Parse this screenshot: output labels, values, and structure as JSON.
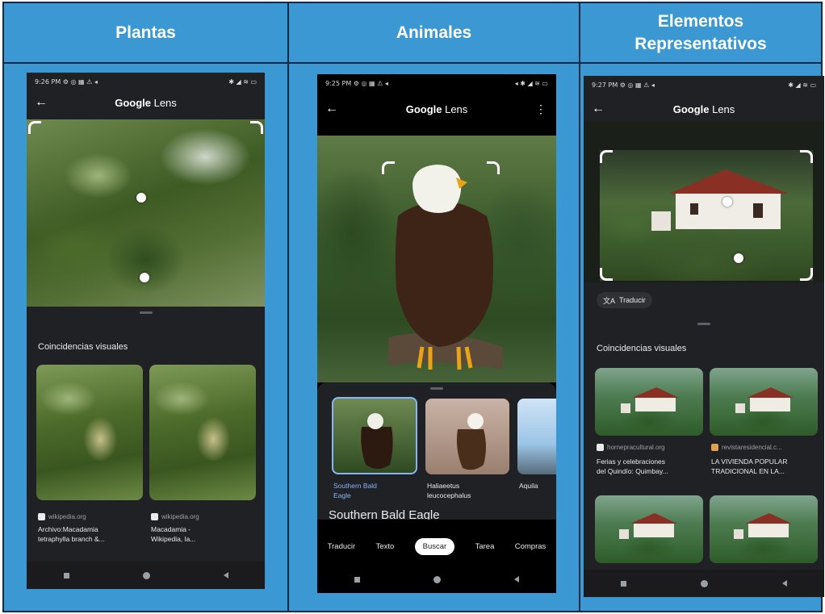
{
  "headers": {
    "col1": "Plantas",
    "col2": "Animales",
    "col3_line1": "Elementos",
    "col3_line2": "Representativos"
  },
  "phones": {
    "plantas": {
      "status_time": "9:26 PM ⚙ ◎ ▦ ⚠ ◂",
      "status_right": "✱ ◢ ≋ ▭",
      "app_title_bold": "Google",
      "app_title_rest": " Lens",
      "section_title": "Coincidencias visuales",
      "results": [
        {
          "source": "wikipedia.org",
          "desc_line1": "Archivo:Macadamia",
          "desc_line2": "tetraphylla branch &..."
        },
        {
          "source": "wikipedia.org",
          "desc_line1": "Macadamia -",
          "desc_line2": "Wikipedia, la..."
        }
      ]
    },
    "animales": {
      "status_time": "9:25 PM ⚙ ◎ ▦ ⚠ ◂",
      "status_right": "◂ ✱ ◢ ≋ ▭",
      "app_title_bold": "Google",
      "app_title_rest": " Lens",
      "more_icon": "⋮",
      "results": [
        {
          "label_line1": "Southern Bald",
          "label_line2": "Eagle",
          "selected": true
        },
        {
          "label_line1": "Haliaeetus",
          "label_line2": "leucocephalus",
          "selected": false
        },
        {
          "label_line1": "Aquila",
          "label_line2": "",
          "selected": false
        }
      ],
      "result_heading": "Southern Bald Eagle",
      "tabs": [
        "Traducir",
        "Texto",
        "Buscar",
        "Tarea",
        "Compras"
      ],
      "active_tab": "Buscar"
    },
    "elementos": {
      "status_time": "9:27 PM ⚙ ◎ ▦ ⚠ ◂",
      "status_right": "✱ ◢ ≋ ▭",
      "app_title_bold": "Google",
      "app_title_rest": " Lens",
      "translate_chip": "Traducir",
      "section_title": "Coincidencias visuales",
      "results": [
        {
          "source": "hornepracultural.org",
          "desc_line1": "Ferias y celebraciones",
          "desc_line2": "del Quindío: Quimbay..."
        },
        {
          "source": "revistaresidencial.c...",
          "desc_line1": "LA VIVIENDA POPULAR",
          "desc_line2": "TRADICIONAL EN LA..."
        }
      ]
    }
  },
  "colors": {
    "background_blue": "#3b98d2",
    "border_navy": "#0f2a44",
    "phone_dark": "#202124",
    "selected_blue": "#8ab4f8"
  }
}
